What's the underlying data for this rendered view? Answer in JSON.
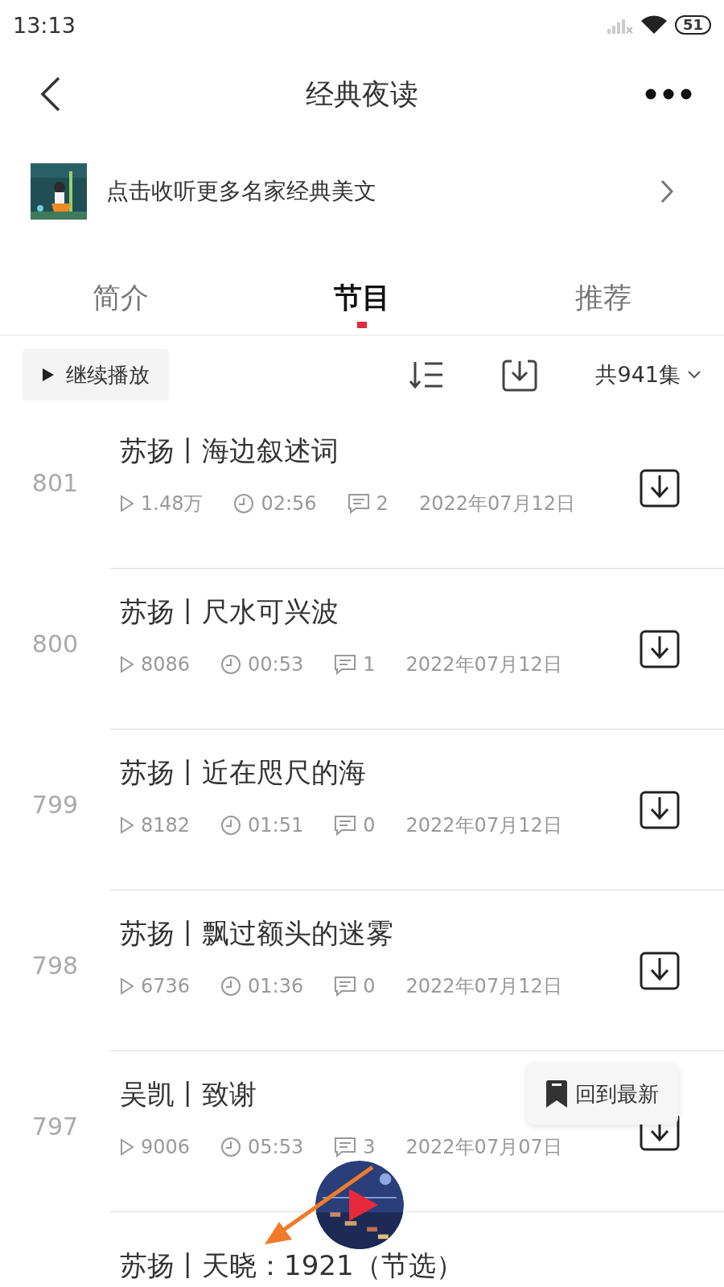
{
  "status_bar": {
    "time": "13:13",
    "battery": "51"
  },
  "header": {
    "title": "经典夜读"
  },
  "banner": {
    "text": "点击收听更多名家经典美文"
  },
  "tabs": [
    {
      "label": "简介",
      "selected": false
    },
    {
      "label": "节目",
      "selected": true
    },
    {
      "label": "推荐",
      "selected": false
    }
  ],
  "toolbar": {
    "continue_button": "继续播放",
    "episode_count": "共941集"
  },
  "episodes": [
    {
      "number": "801",
      "title": "苏扬丨海边叙述词",
      "plays": "1.48万",
      "duration": "02:56",
      "comments": "2",
      "date": "2022年07月12日"
    },
    {
      "number": "800",
      "title": "苏扬丨尺水可兴波",
      "plays": "8086",
      "duration": "00:53",
      "comments": "1",
      "date": "2022年07月12日"
    },
    {
      "number": "799",
      "title": "苏扬丨近在咫尺的海",
      "plays": "8182",
      "duration": "01:51",
      "comments": "0",
      "date": "2022年07月12日"
    },
    {
      "number": "798",
      "title": "苏扬丨飘过额头的迷雾",
      "plays": "6736",
      "duration": "01:36",
      "comments": "0",
      "date": "2022年07月12日"
    },
    {
      "number": "797",
      "title": "吴凯丨致谢",
      "plays": "9006",
      "duration": "05:53",
      "comments": "3",
      "date": "2022年07月07日"
    },
    {
      "title": "苏扬丨天晓：1921（节选）"
    }
  ],
  "floating_button": {
    "label": "回到最新"
  }
}
